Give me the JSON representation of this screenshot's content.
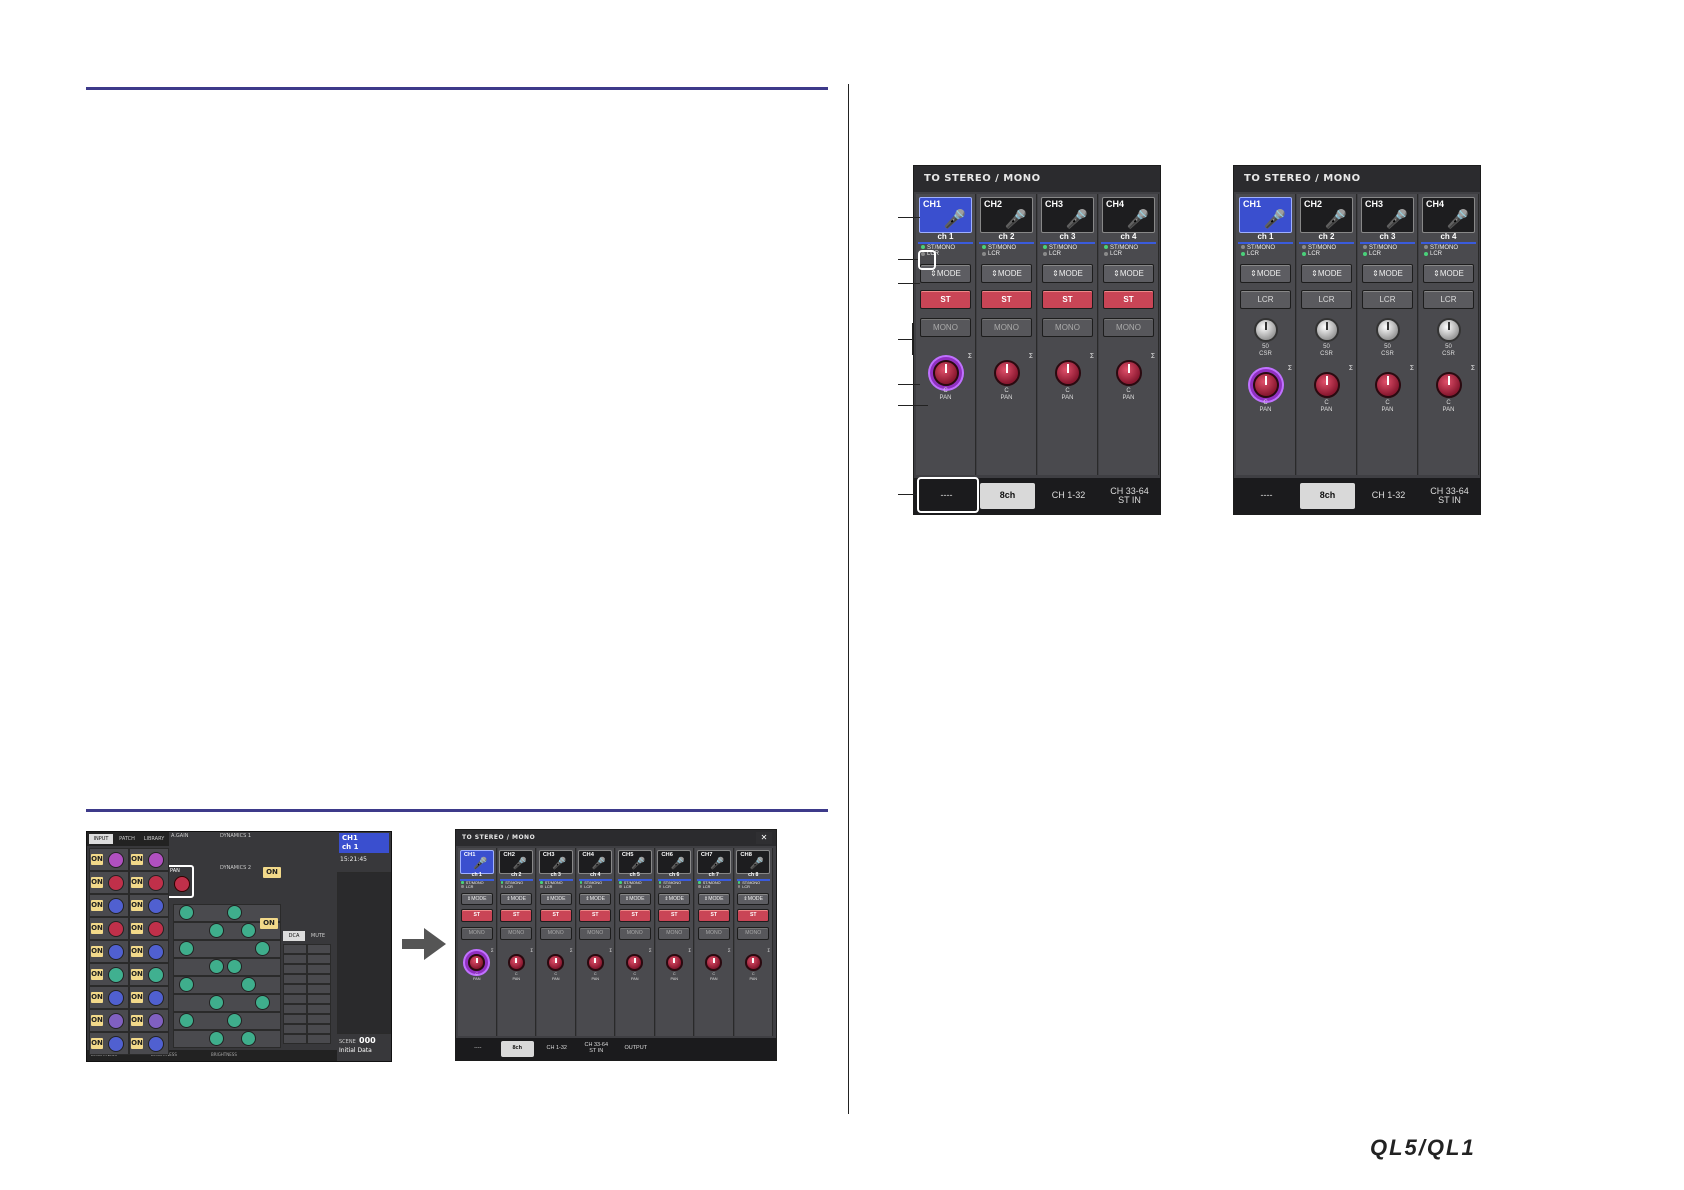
{
  "panel_title": "TO STEREO / MONO",
  "channels": [
    {
      "num": "CH1",
      "name": "ch 1"
    },
    {
      "num": "CH2",
      "name": "ch 2"
    },
    {
      "num": "CH3",
      "name": "ch 3"
    },
    {
      "num": "CH4",
      "name": "ch 4"
    }
  ],
  "indicators": {
    "st_mono": "ST/MONO",
    "lcr": "LCR"
  },
  "buttons": {
    "mode": "⇕MODE",
    "st": "ST",
    "mono": "MONO",
    "lcr": "LCR",
    "close": "✕"
  },
  "knob": {
    "pan_value": "C",
    "pan_label": "PAN",
    "csr_value": "50",
    "csr_label": "CSR",
    "sigma": "Σ"
  },
  "tabs_panel": [
    "----",
    "8ch",
    "CH 1-32",
    "CH 33-64\nST IN"
  ],
  "tabs_8ch": [
    "----",
    "8ch",
    "CH 1-32",
    "CH 33-64\nST IN",
    "OUTPUT"
  ],
  "channels_8": [
    {
      "num": "CH1",
      "name": "ch 1"
    },
    {
      "num": "CH2",
      "name": "ch 2"
    },
    {
      "num": "CH3",
      "name": "ch 3"
    },
    {
      "num": "CH4",
      "name": "ch 4"
    },
    {
      "num": "CH5",
      "name": "ch 5"
    },
    {
      "num": "CH6",
      "name": "ch 6"
    },
    {
      "num": "CH7",
      "name": "ch 7"
    },
    {
      "num": "CH8",
      "name": "ch 8"
    }
  ],
  "overview": {
    "tabs": [
      "INPUT",
      "PATCH",
      "LIBRARY"
    ],
    "header": [
      "A.GAIN",
      "DYNAMICS 1",
      "DYNAMICS 2"
    ],
    "channel": {
      "num": "CH1",
      "name": "ch 1"
    },
    "time": "15:21:45",
    "scene_label": "SCENE",
    "scene_num": "000",
    "scene_name": "Initial Data",
    "pan_label": "PAN",
    "on_label": "ON",
    "side_labels": [
      "DCA",
      "MUTE"
    ],
    "bottom_labels": [
      "BRIGHTNESS",
      "BRIGHTNESS",
      "BRIGHTNESS"
    ]
  },
  "logo": "QL5/QL1"
}
